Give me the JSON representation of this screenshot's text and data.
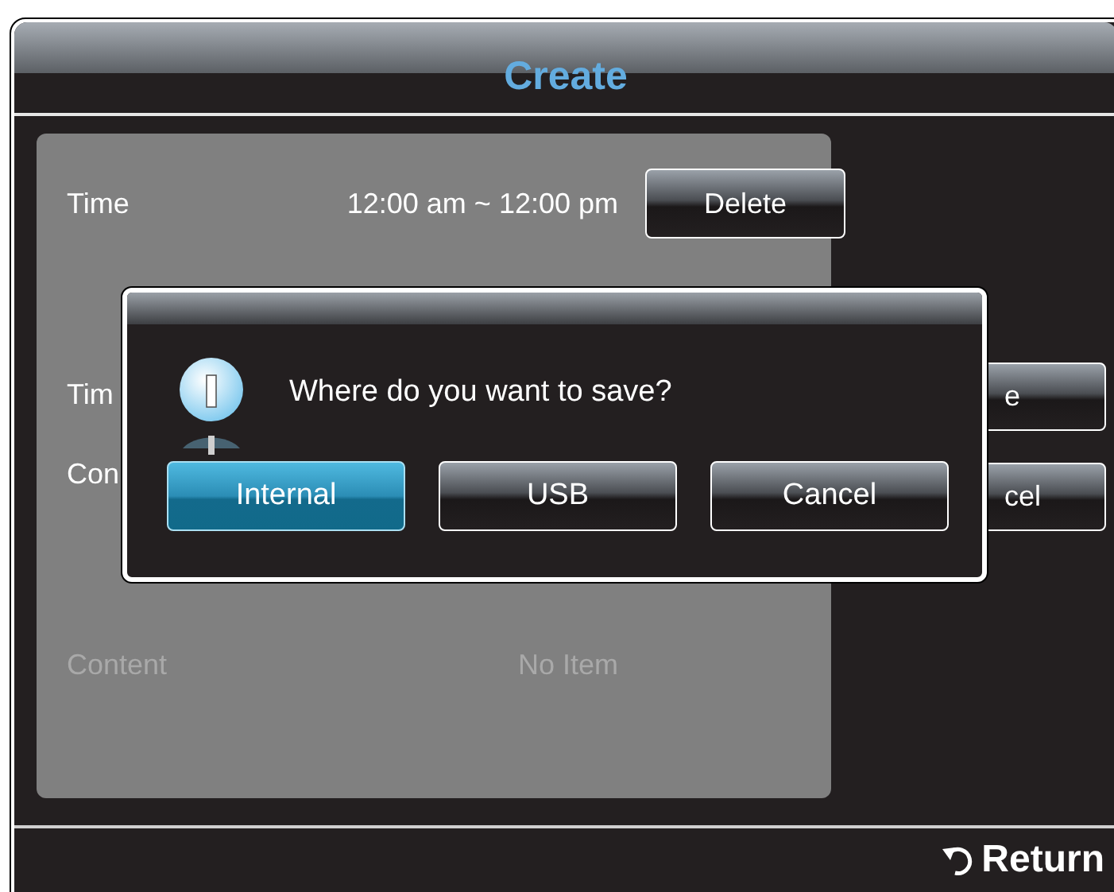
{
  "window": {
    "title": "Create"
  },
  "rows": [
    {
      "label": "Time",
      "value": "12:00 am ~ 12:00 pm",
      "disabled": false,
      "action": "Delete"
    },
    {
      "label": "Tim",
      "disabled": false
    },
    {
      "label": "Con",
      "disabled": false
    },
    {
      "label": "Content",
      "value": "No Item",
      "disabled": true
    }
  ],
  "side_buttons": [
    "e",
    "cel"
  ],
  "dialog": {
    "message": "Where do you want to save?",
    "buttons": [
      {
        "label": "Internal",
        "selected": true
      },
      {
        "label": "USB",
        "selected": false
      },
      {
        "label": "Cancel",
        "selected": false
      }
    ]
  },
  "footer": {
    "return": "Return"
  }
}
